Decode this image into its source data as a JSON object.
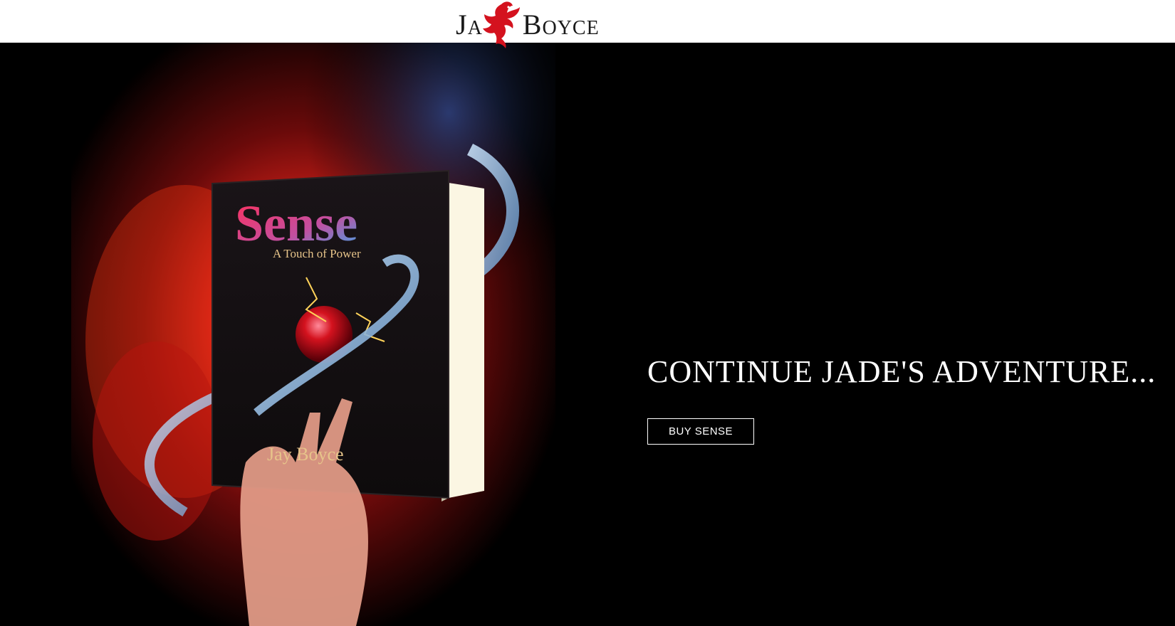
{
  "header": {
    "logo_left": "Ja",
    "logo_right": "Boyce",
    "logo_icon": "phoenix-icon",
    "logo_color": "#d4121e"
  },
  "hero": {
    "cover_title": "Sense",
    "cover_subtitle": "A Touch of Power",
    "cover_author": "Jay Boyce",
    "headline": "CONTINUE JADE'S ADVENTURE...",
    "cta_label": "BUY SENSE"
  },
  "colors": {
    "background": "#000000",
    "header_bg": "#ffffff",
    "accent_red": "#d4121e",
    "text_white": "#ffffff"
  }
}
